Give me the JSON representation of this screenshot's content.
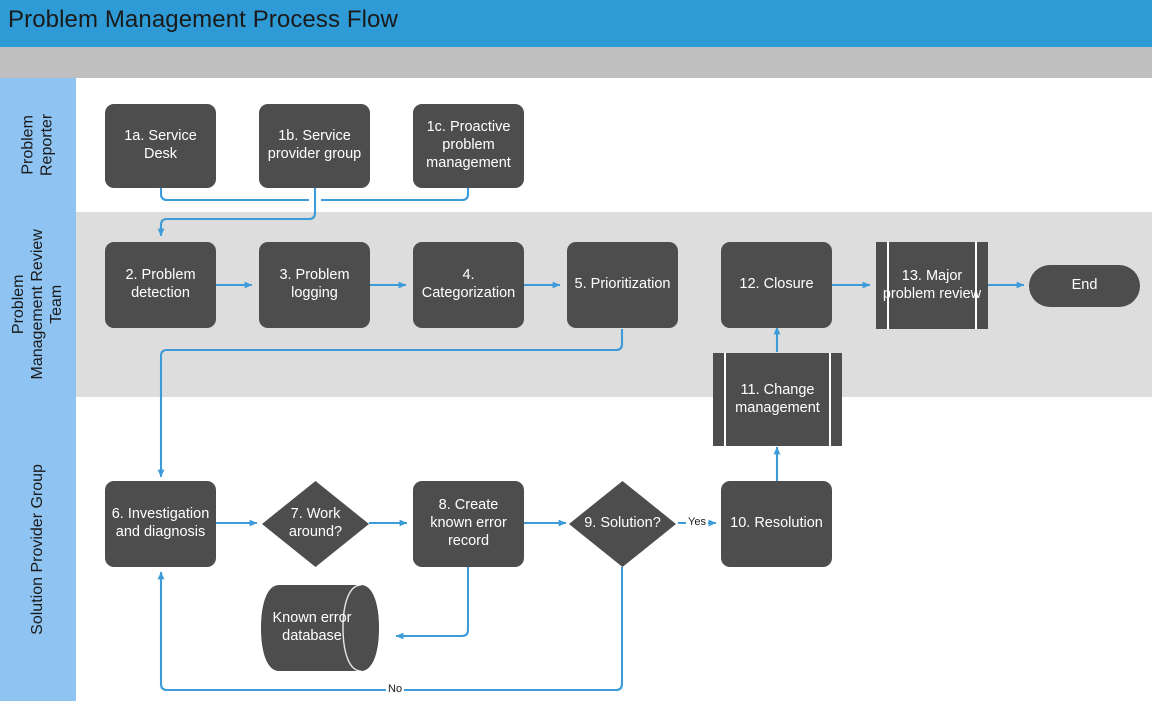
{
  "title": "Problem Management Process Flow",
  "colors": {
    "title_bar": "#2E9BD6",
    "spacer_band": "#BFBFBF",
    "lane_header": "#8FC4F2",
    "lane_alt_background": "#DDDDDD",
    "node_fill": "#4D4D4D",
    "node_text": "#FFFFFF",
    "connector": "#3C9BD8"
  },
  "lanes": [
    {
      "id": "problem-reporter",
      "label": "Problem\nReporter"
    },
    {
      "id": "problem-management-review-team",
      "label": "Problem\nManagement Review\nTeam"
    },
    {
      "id": "solution-provider-group",
      "label": "Solution Provider Group"
    }
  ],
  "nodes": {
    "n1a": {
      "label": "1a. Service Desk",
      "shape": "process"
    },
    "n1b": {
      "label": "1b. Service provider group",
      "shape": "process"
    },
    "n1c": {
      "label": "1c. Proactive problem management",
      "shape": "process"
    },
    "n2": {
      "label": "2. Problem detection",
      "shape": "process"
    },
    "n3": {
      "label": "3. Problem logging",
      "shape": "process"
    },
    "n4": {
      "label": "4. Categorization",
      "shape": "process"
    },
    "n5": {
      "label": "5. Prioritization",
      "shape": "process"
    },
    "n12": {
      "label": "12. Closure",
      "shape": "process"
    },
    "n13": {
      "label": "13. Major problem review",
      "shape": "subprocess"
    },
    "nend": {
      "label": "End",
      "shape": "terminator"
    },
    "n6": {
      "label": "6. Investigation and diagnosis",
      "shape": "process"
    },
    "n7": {
      "label": "7. Work around?",
      "shape": "decision"
    },
    "n8": {
      "label": "8. Create known error record",
      "shape": "process"
    },
    "n9": {
      "label": "9. Solution?",
      "shape": "decision"
    },
    "n10": {
      "label": "10. Resolution",
      "shape": "process"
    },
    "n11": {
      "label": "11. Change management",
      "shape": "subprocess"
    },
    "ndb": {
      "label": "Known error database",
      "shape": "database"
    }
  },
  "edge_labels": {
    "yes": "Yes",
    "no": "No"
  }
}
